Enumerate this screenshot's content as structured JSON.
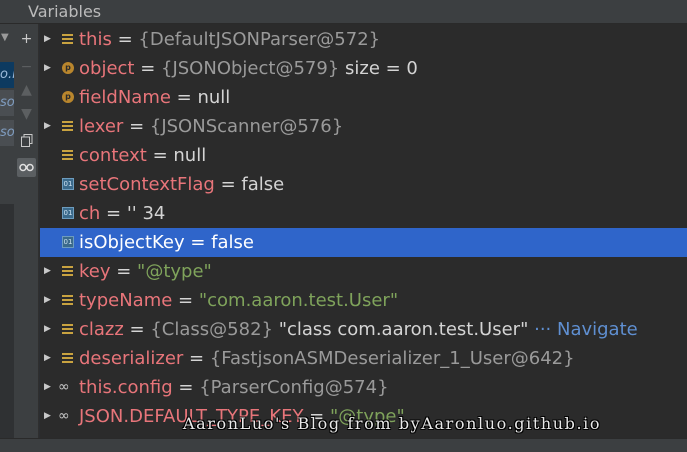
{
  "panel": {
    "title": "Variables"
  },
  "frames": [
    "o.l",
    "so",
    "so"
  ],
  "variables": [
    {
      "name": "this",
      "value": "{DefaultJSONParser@572}",
      "value_kind": "ref",
      "icon": "field-icon",
      "expandable": true
    },
    {
      "name": "object",
      "value": "{JSONObject@579}",
      "value_kind": "ref",
      "extra": " size = 0",
      "icon": "param-icon",
      "expandable": true
    },
    {
      "name": "fieldName",
      "value": "null",
      "value_kind": "plain",
      "icon": "param-icon",
      "expandable": false
    },
    {
      "name": "lexer",
      "value": "{JSONScanner@576}",
      "value_kind": "ref",
      "icon": "field-icon",
      "expandable": true
    },
    {
      "name": "context",
      "value": "null",
      "value_kind": "plain",
      "icon": "field-icon",
      "expandable": false
    },
    {
      "name": "setContextFlag",
      "value": "false",
      "value_kind": "plain",
      "icon": "primitive-icon",
      "expandable": false
    },
    {
      "name": "ch",
      "value": "'' 34",
      "value_kind": "plain",
      "icon": "primitive-icon",
      "expandable": false
    },
    {
      "name": "isObjectKey",
      "value": "false",
      "value_kind": "plain",
      "icon": "primitive-icon",
      "expandable": false,
      "selected": true
    },
    {
      "name": "key",
      "value": "\"@type\"",
      "value_kind": "string",
      "icon": "field-icon",
      "expandable": true
    },
    {
      "name": "typeName",
      "value": "\"com.aaron.test.User\"",
      "value_kind": "string",
      "icon": "field-icon",
      "expandable": true
    },
    {
      "name": "clazz",
      "value": "{Class@582}",
      "value_kind": "ref",
      "extra": " \"class com.aaron.test.User\"",
      "link": "··· Navigate",
      "icon": "field-icon",
      "expandable": true
    },
    {
      "name": "deserializer",
      "value": "{FastjsonASMDeserializer_1_User@642}",
      "value_kind": "ref",
      "icon": "field-icon",
      "expandable": true
    },
    {
      "name": "this.config",
      "value": "{ParserConfig@574}",
      "value_kind": "ref",
      "icon": "watch-icon",
      "expandable": true
    },
    {
      "name": "JSON.DEFAULT_TYPE_KEY",
      "value": "\"@type\"",
      "value_kind": "string",
      "icon": "watch-icon",
      "expandable": true
    }
  ],
  "watermark": "AaronLuo's Blog from byAaronluo.github.io",
  "colors": {
    "selection": "#2f65ca",
    "name": "#e8757a",
    "string": "#7fa35b",
    "link": "#5f8fd1",
    "background": "#2b2b2b"
  }
}
